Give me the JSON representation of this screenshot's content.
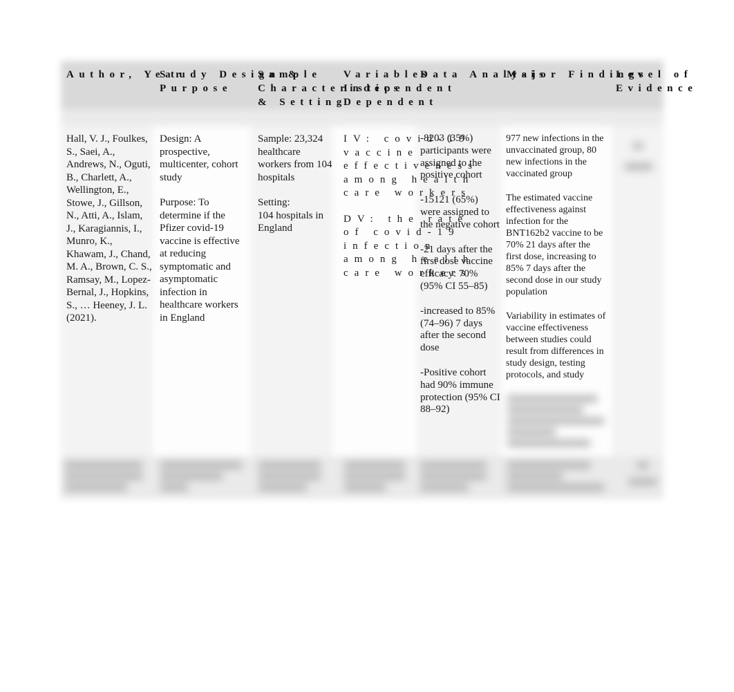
{
  "table": {
    "headers": [
      "Author, Year",
      "Study Design &\nPurpose",
      "Sample\nCharacteristics\n& Setting",
      "Variables\nIndependent\nDependent",
      "Data Analysis",
      "Major Findings",
      "Level of\nEvidence"
    ],
    "rows": [
      {
        "author": "Hall, V. J., Foulkes, S., Saei, A., Andrews, N., Oguti, B., Charlett, A., Wellington, E., Stowe, J., Gillson, N., Atti, A., Islam, J., Karagiannis, I., Munro, K., Khawam, J., Chand, M. A., Brown, C. S., Ramsay, M., Lopez-Bernal, J., Hopkins, S., … Heeney, J. L. (2021).",
        "design": "Design: A prospective, multicenter, cohort study",
        "purpose": "Purpose: To determine if the Pfizer covid-19 vaccine is effective at reducing symptomatic and asymptomatic infection in healthcare workers in England",
        "sample": "Sample: 23,324 healthcare workers from 104 hospitals",
        "setting_label": "Setting:",
        "setting": "104 hospitals in England",
        "iv": "IV: covid-19 vaccine effectiveness among health care workers",
        "dv": "DV: the rate of covid-19 infection among health care workers",
        "analysis": [
          "-8203 (35%) participants were assigned to the positive cohort",
          "-15121 (65%) were assigned to the negative cohort",
          "-21 days after the first dose vaccine efficacy: 70% (95% CI 55–85)",
          "-increased to 85% (74–96) 7 days after the second dose",
          "-Positive cohort had 90% immune protection (95% CI 88–92)"
        ],
        "findings": [
          "977 new infections in the unvaccinated group, 80 new infections in the vaccinated group",
          "The estimated vaccine effectiveness against infection for the BNT162b2 vaccine to be 70% 21 days after the first dose, increasing to 85% 7 days after the second dose in our study population",
          "Variability in estimates of vaccine effectiveness between studies could result from differences in study design, testing protocols, and study"
        ]
      }
    ]
  }
}
